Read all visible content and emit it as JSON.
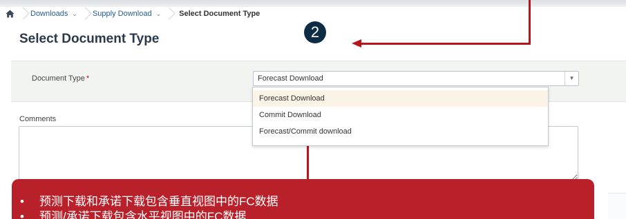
{
  "breadcrumb": {
    "items": [
      {
        "label": "Downloads"
      },
      {
        "label": "Supply Download"
      }
    ],
    "current": "Select Document Type"
  },
  "page": {
    "title": "Select Document Type",
    "step_number": "2"
  },
  "form": {
    "document_type_label": "Document Type",
    "required_mark": "*",
    "document_type_value": "Forecast Download",
    "comments_label": "Comments"
  },
  "dropdown": {
    "options": [
      {
        "label": "Forecast Download",
        "selected": true
      },
      {
        "label": "Commit Download",
        "selected": false
      },
      {
        "label": "Forecast/Commit download",
        "selected": false
      }
    ]
  },
  "callout": {
    "bullets": [
      "预测下载和承诺下载包含垂直视图中的FC数据",
      "预测/承诺下载包含水平视图中的FC数据"
    ]
  },
  "colors": {
    "annotation_red": "#b5151b",
    "callout_red": "#b8202a",
    "badge_navy": "#0f2c45",
    "link_blue": "#1f5c99"
  },
  "icons": [
    "home-icon",
    "chevron-down-icon"
  ]
}
